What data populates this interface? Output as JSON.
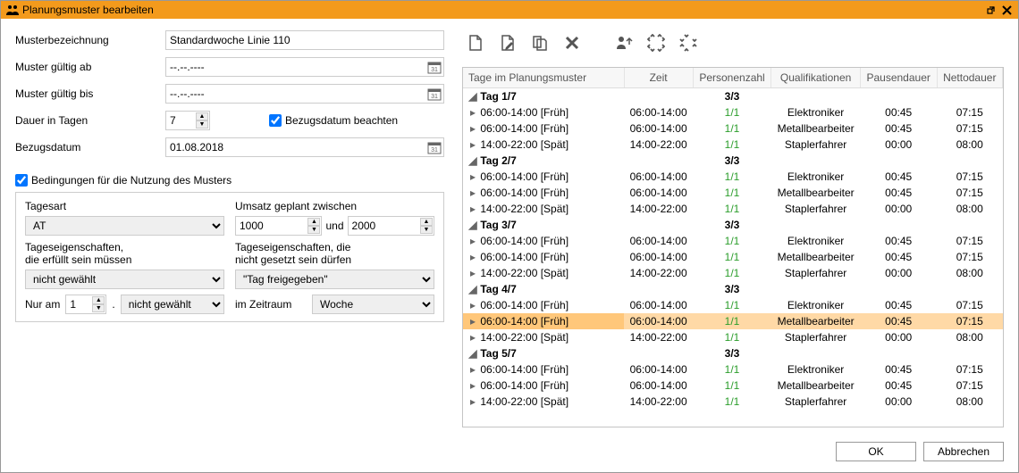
{
  "window_title": "Planungsmuster bearbeiten",
  "form": {
    "name_label": "Musterbezeichnung",
    "name_value": "Standardwoche Linie 110",
    "valid_from_label": "Muster gültig ab",
    "valid_from_value": "--.--.----",
    "valid_to_label": "Muster gültig bis",
    "valid_to_value": "--.--.----",
    "duration_label": "Dauer in Tagen",
    "duration_value": "7",
    "ref_date_cbx": "Bezugsdatum beachten",
    "ref_date_label": "Bezugsdatum",
    "ref_date_value": "01.08.2018",
    "conditions_cbx": "Bedingungen für die Nutzung des Musters",
    "cond": {
      "tagesart_label": "Tagesart",
      "tagesart_value": "AT",
      "umsatz_label": "Umsatz geplant zwischen",
      "umsatz_from": "1000",
      "umsatz_und": "und",
      "umsatz_to": "2000",
      "props_must_label1": "Tageseigenschaften,",
      "props_must_label2": "die erfüllt sein müssen",
      "props_must_value": "nicht gewählt",
      "props_mustnot_label1": "Tageseigenschaften, die",
      "props_mustnot_label2": "nicht gesetzt sein dürfen",
      "props_mustnot_value": "\"Tag freigegeben\"",
      "nur_am_label": "Nur am",
      "nur_am_num": "1",
      "nur_am_dot": ".",
      "nur_am_sel": "nicht gewählt",
      "zeitraum_label": "im Zeitraum",
      "zeitraum_value": "Woche"
    }
  },
  "grid": {
    "headers": [
      "Tage im Planungsmuster",
      "Zeit",
      "Personenzahl",
      "Qualifikationen",
      "Pausendauer",
      "Nettodauer"
    ],
    "day_label_prefix": "Tag",
    "rows": [
      {
        "type": "day",
        "label": "Tag 1/7",
        "pers": "3/3"
      },
      {
        "type": "shift",
        "label": "06:00-14:00 [Früh]",
        "zeit": "06:00-14:00",
        "pers": "1/1",
        "qual": "Elektroniker",
        "pause": "00:45",
        "netto": "07:15"
      },
      {
        "type": "shift",
        "label": "06:00-14:00 [Früh]",
        "zeit": "06:00-14:00",
        "pers": "1/1",
        "qual": "Metallbearbeiter",
        "pause": "00:45",
        "netto": "07:15"
      },
      {
        "type": "shift",
        "label": "14:00-22:00 [Spät]",
        "zeit": "14:00-22:00",
        "pers": "1/1",
        "qual": "Staplerfahrer",
        "pause": "00:00",
        "netto": "08:00"
      },
      {
        "type": "day",
        "label": "Tag 2/7",
        "pers": "3/3"
      },
      {
        "type": "shift",
        "label": "06:00-14:00 [Früh]",
        "zeit": "06:00-14:00",
        "pers": "1/1",
        "qual": "Elektroniker",
        "pause": "00:45",
        "netto": "07:15"
      },
      {
        "type": "shift",
        "label": "06:00-14:00 [Früh]",
        "zeit": "06:00-14:00",
        "pers": "1/1",
        "qual": "Metallbearbeiter",
        "pause": "00:45",
        "netto": "07:15"
      },
      {
        "type": "shift",
        "label": "14:00-22:00 [Spät]",
        "zeit": "14:00-22:00",
        "pers": "1/1",
        "qual": "Staplerfahrer",
        "pause": "00:00",
        "netto": "08:00"
      },
      {
        "type": "day",
        "label": "Tag 3/7",
        "pers": "3/3"
      },
      {
        "type": "shift",
        "label": "06:00-14:00 [Früh]",
        "zeit": "06:00-14:00",
        "pers": "1/1",
        "qual": "Elektroniker",
        "pause": "00:45",
        "netto": "07:15"
      },
      {
        "type": "shift",
        "label": "06:00-14:00 [Früh]",
        "zeit": "06:00-14:00",
        "pers": "1/1",
        "qual": "Metallbearbeiter",
        "pause": "00:45",
        "netto": "07:15"
      },
      {
        "type": "shift",
        "label": "14:00-22:00 [Spät]",
        "zeit": "14:00-22:00",
        "pers": "1/1",
        "qual": "Staplerfahrer",
        "pause": "00:00",
        "netto": "08:00"
      },
      {
        "type": "day",
        "label": "Tag 4/7",
        "pers": "3/3"
      },
      {
        "type": "shift",
        "label": "06:00-14:00 [Früh]",
        "zeit": "06:00-14:00",
        "pers": "1/1",
        "qual": "Elektroniker",
        "pause": "00:45",
        "netto": "07:15"
      },
      {
        "type": "shift",
        "label": "06:00-14:00 [Früh]",
        "zeit": "06:00-14:00",
        "pers": "1/1",
        "qual": "Metallbearbeiter",
        "pause": "00:45",
        "netto": "07:15",
        "selected": true
      },
      {
        "type": "shift",
        "label": "14:00-22:00 [Spät]",
        "zeit": "14:00-22:00",
        "pers": "1/1",
        "qual": "Staplerfahrer",
        "pause": "00:00",
        "netto": "08:00"
      },
      {
        "type": "day",
        "label": "Tag 5/7",
        "pers": "3/3"
      },
      {
        "type": "shift",
        "label": "06:00-14:00 [Früh]",
        "zeit": "06:00-14:00",
        "pers": "1/1",
        "qual": "Elektroniker",
        "pause": "00:45",
        "netto": "07:15"
      },
      {
        "type": "shift",
        "label": "06:00-14:00 [Früh]",
        "zeit": "06:00-14:00",
        "pers": "1/1",
        "qual": "Metallbearbeiter",
        "pause": "00:45",
        "netto": "07:15"
      },
      {
        "type": "shift",
        "label": "14:00-22:00 [Spät]",
        "zeit": "14:00-22:00",
        "pers": "1/1",
        "qual": "Staplerfahrer",
        "pause": "00:00",
        "netto": "08:00"
      }
    ]
  },
  "buttons": {
    "ok": "OK",
    "cancel": "Abbrechen"
  }
}
